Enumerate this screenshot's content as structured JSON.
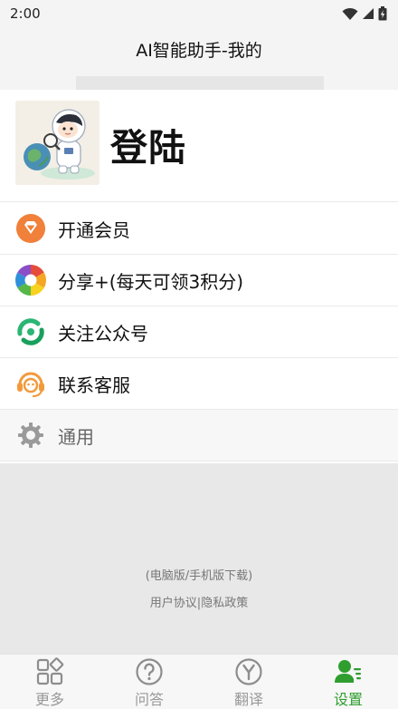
{
  "status_bar": {
    "time": "2:00"
  },
  "header": {
    "title": "AI智能助手-我的"
  },
  "profile": {
    "login_label": "登陆"
  },
  "menu": {
    "items": [
      {
        "label": "开通会员",
        "icon": "vip-diamond-icon"
      },
      {
        "label": "分享+(每天可领3积分)",
        "icon": "share-aperture-icon"
      },
      {
        "label": "关注公众号",
        "icon": "follow-account-icon"
      },
      {
        "label": "联系客服",
        "icon": "customer-service-icon"
      },
      {
        "label": "通用",
        "icon": "gear-icon"
      }
    ]
  },
  "footer": {
    "download": "(电脑版/手机版下载)",
    "user_agreement": "用户协议",
    "separator": "|",
    "privacy_policy": "隐私政策"
  },
  "bottom_nav": {
    "items": [
      {
        "label": "更多",
        "icon": "grid-icon"
      },
      {
        "label": "问答",
        "icon": "question-icon"
      },
      {
        "label": "翻译",
        "icon": "translate-icon"
      },
      {
        "label": "设置",
        "icon": "profile-settings-icon",
        "active": true
      }
    ]
  },
  "colors": {
    "accent": "#2f9e2f",
    "muted_text": "#777777",
    "content_background": "#e8e8e8"
  }
}
